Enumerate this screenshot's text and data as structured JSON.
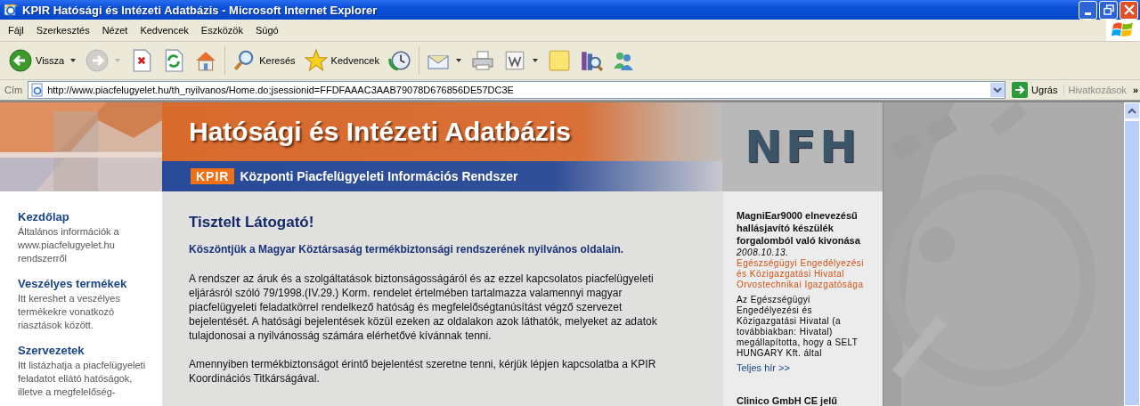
{
  "window": {
    "title": "KPIR Hatósági és Intézeti Adatbázis - Microsoft Internet Explorer"
  },
  "menu": [
    "Fájl",
    "Szerkesztés",
    "Nézet",
    "Kedvencek",
    "Eszközök",
    "Súgó"
  ],
  "toolbar": [
    {
      "kind": "back",
      "label": "Vissza",
      "dropdown": true,
      "disabled": false
    },
    {
      "kind": "forward",
      "dropdown": true,
      "disabled": true
    },
    {
      "kind": "stop",
      "dropdown": false,
      "disabled": false
    },
    {
      "kind": "refresh",
      "dropdown": false,
      "disabled": false
    },
    {
      "kind": "home",
      "dropdown": false,
      "disabled": false
    },
    {
      "kind": "search",
      "label": "Keresés",
      "dropdown": false,
      "disabled": false
    },
    {
      "kind": "favorites",
      "label": "Kedvencek",
      "dropdown": false,
      "disabled": false
    },
    {
      "kind": "history",
      "dropdown": false,
      "disabled": false
    },
    {
      "kind": "mail",
      "dropdown": true,
      "disabled": false
    },
    {
      "kind": "print",
      "dropdown": false,
      "disabled": false
    },
    {
      "kind": "word",
      "dropdown": true,
      "disabled": false
    },
    {
      "kind": "note",
      "dropdown": false,
      "disabled": false
    },
    {
      "kind": "research",
      "dropdown": false,
      "disabled": false
    },
    {
      "kind": "messenger",
      "dropdown": false,
      "disabled": false
    }
  ],
  "address": {
    "label": "Cím",
    "value": "http://www.piacfelugyelet.hu/th_nyilvanos/Home.do;jsessionid=FFDFAAAC3AAB79078D676856DE57DC3E",
    "go": "Ugrás",
    "links": "Hivatkozások",
    "more": "»"
  },
  "header": {
    "title": "Hatósági és Intézeti Adatbázis",
    "logo": "KPIR",
    "subtitle": "Központi Piacfelügyeleti Információs Rendszer",
    "agency": "NFH"
  },
  "nav": [
    {
      "title": "Kezdőlap",
      "text": "Általános információk a www.piacfelugyelet.hu rendszerről"
    },
    {
      "title": "Veszélyes termékek",
      "text": "Itt kereshet a veszélyes termékekre vonatkozó riasztások között."
    },
    {
      "title": "Szervezetek",
      "text": "Itt listázhatja a piacfelügyeleti feladatot ellátó hatóságok, illetve a megfelelőség-"
    }
  ],
  "main": {
    "heading": "Tisztelt Látogató!",
    "intro": "Köszöntjük a Magyar Köztársaság termékbiztonsági rendszerének nyilvános oldalain.",
    "paragraphs": [
      "A rendszer az áruk és a szolgáltatások biztonságosságáról és az ezzel kapcsolatos piacfelügyeleti eljárásról szóló 79/1998.(IV.29.) Korm. rendelet értelmében tartalmazza valamennyi magyar piacfelügyeleti feladatkörrel rendelkező hatóság és megfelelőségtanúsítást végző szervezet bejelentését. A hatósági bejelentések közül ezeken az oldalakon azok láthatók, melyeket az adatok tulajdonosai a nyilvánosság számára elérhetővé kívánnak tenni.",
      "Amennyiben termékbiztonságot érintő bejelentést szeretne tenni, kérjük lépjen kapcsolatba a KPIR Koordinációs Titkárságával."
    ]
  },
  "news": [
    {
      "title": "MagniEar9000 elnevezésű hallásjavító készülék forgalomból való kivonása",
      "date": "2008.10.13.",
      "source": "Egészségügyi Engedélyezési és Közigazgatási Hivatal Orvostechnikai Igazgatósága",
      "text": "Az Egészségügyi Engedélyezési és Közigazgatási Hivatal (a továbbiakban: Hivatal) megállapította, hogy a SELT HUNGARY Kft. által",
      "link": "Teljes hír >>"
    },
    {
      "title": "Clinico GmbH CE jelű"
    }
  ]
}
